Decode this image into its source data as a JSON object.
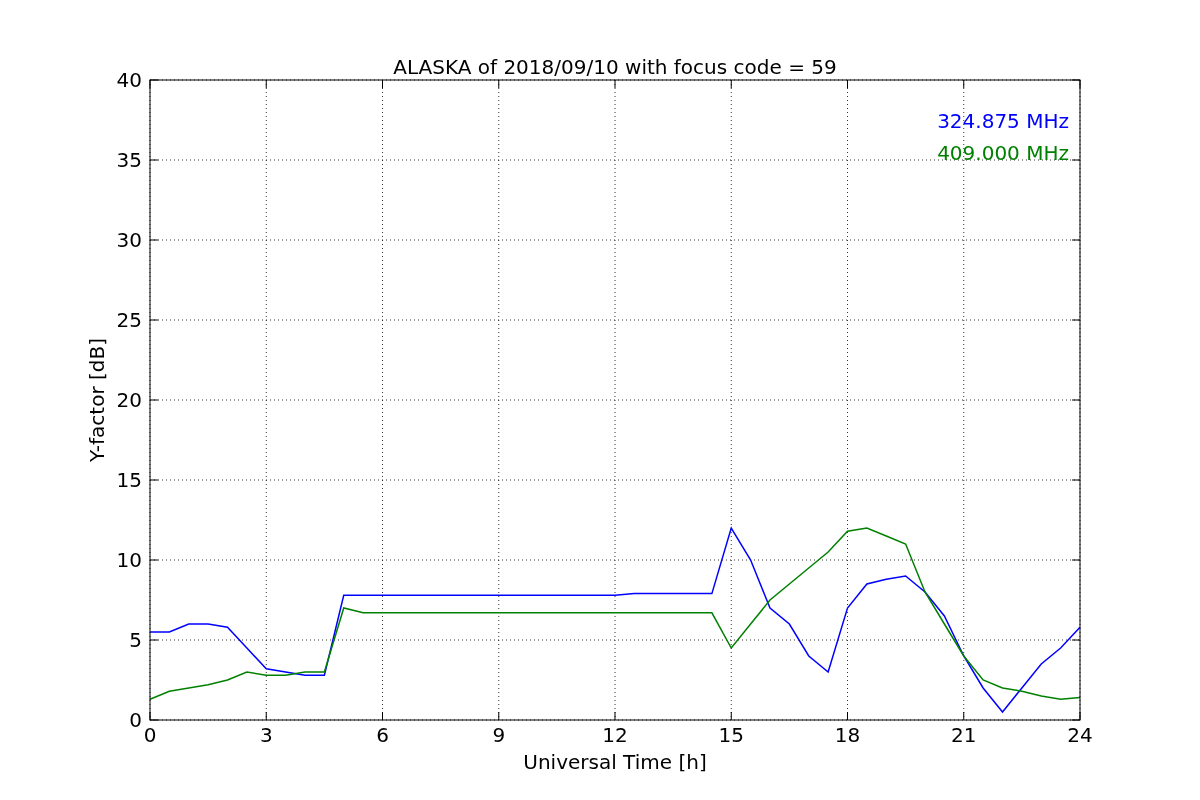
{
  "chart_data": {
    "type": "line",
    "title": "ALASKA of 2018/09/10 with focus code = 59",
    "xlabel": "Universal Time [h]",
    "ylabel": "Y-factor [dB]",
    "x": [
      0,
      0.5,
      1,
      1.5,
      2,
      2.5,
      3,
      3.5,
      4,
      4.5,
      5,
      5.5,
      6,
      6.5,
      7,
      7.5,
      8,
      8.5,
      9,
      9.5,
      10,
      10.5,
      11,
      11.5,
      12,
      12.5,
      13,
      13.5,
      14,
      14.5,
      15,
      15.5,
      16,
      16.5,
      17,
      17.5,
      18,
      18.5,
      19,
      19.5,
      20,
      20.5,
      21,
      21.5,
      22,
      22.5,
      23,
      23.5,
      24
    ],
    "series": [
      {
        "name": "324.875 MHz",
        "color": "#0000ff",
        "values": [
          5.5,
          5.5,
          6,
          6,
          5.8,
          4.5,
          3.2,
          3,
          2.8,
          2.8,
          7.8,
          7.8,
          7.8,
          7.8,
          7.8,
          7.8,
          7.8,
          7.8,
          7.8,
          7.8,
          7.8,
          7.8,
          7.8,
          7.8,
          7.8,
          7.9,
          7.9,
          7.9,
          7.9,
          7.9,
          12,
          10,
          7,
          6,
          4,
          3,
          7,
          8.5,
          8.8,
          9,
          8,
          6.5,
          4,
          2,
          0.5,
          2,
          3.5,
          4.5,
          5.8
        ]
      },
      {
        "name": "409.000 MHz",
        "color": "#008000",
        "values": [
          1.3,
          1.8,
          2,
          2.2,
          2.5,
          3,
          2.8,
          2.8,
          3,
          3,
          7,
          6.7,
          6.7,
          6.7,
          6.7,
          6.7,
          6.7,
          6.7,
          6.7,
          6.7,
          6.7,
          6.7,
          6.7,
          6.7,
          6.7,
          6.7,
          6.7,
          6.7,
          6.7,
          6.7,
          4.5,
          6,
          7.5,
          8.5,
          9.5,
          10.5,
          11.8,
          12,
          11.5,
          11,
          8,
          6,
          4,
          2.5,
          2,
          1.8,
          1.5,
          1.3,
          1.4
        ]
      }
    ],
    "xlim": [
      0,
      24
    ],
    "ylim": [
      0,
      40
    ],
    "xticks": [
      0,
      3,
      6,
      9,
      12,
      15,
      18,
      21,
      24
    ],
    "yticks": [
      0,
      5,
      10,
      15,
      20,
      25,
      30,
      35,
      40
    ],
    "grid": true
  }
}
